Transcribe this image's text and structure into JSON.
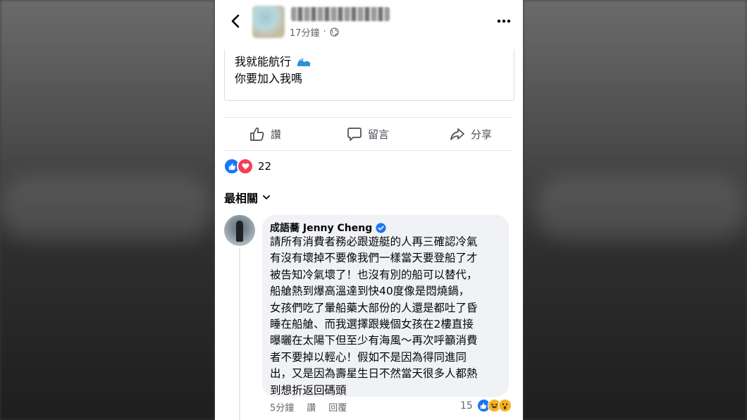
{
  "header": {
    "time": "17分鐘",
    "separator": "·",
    "icons": {
      "back": "chevron-left-icon",
      "privacy": "globe-icon",
      "more": "more-horizontal-icon"
    }
  },
  "post": {
    "line1": "我就能航行",
    "line2": "你要加入我嗎"
  },
  "actions": {
    "like": "讚",
    "comment": "留言",
    "share": "分享"
  },
  "reactions": {
    "count": "22"
  },
  "comments_filter": {
    "label": "最相關"
  },
  "comment": {
    "author": "成語蕎 Jenny Cheng",
    "verified": true,
    "lines": [
      "請所有消費者務必跟遊艇的人再三確認冷氣",
      "有沒有壞掉不要像我們一樣當天要登船了才",
      "被告知冷氣壞了！也沒有別的船可以替代，",
      "船艙熱到爆高溫達到快40度像是悶燒鍋，",
      "女孩們吃了暈船藥大部份的人還是都吐了昏",
      "睡在船艙、而我選擇跟幾個女孩在2樓直接",
      "曝曬在太陽下但至少有海風～再次呼籲消費",
      "者不要掉以輕心！假如不是因為得同進同",
      "出，又是因為壽星生日不然當天很多人都熱",
      "到想折返回碼頭"
    ],
    "time": "5分鐘",
    "like_label": "讚",
    "reply_label": "回覆",
    "reaction_count": "15"
  },
  "colors": {
    "facebook_blue": "#1877f2",
    "love_red": "#f33e58",
    "bubble_bg": "#f0f2f5",
    "meta_gray": "#65676b"
  }
}
